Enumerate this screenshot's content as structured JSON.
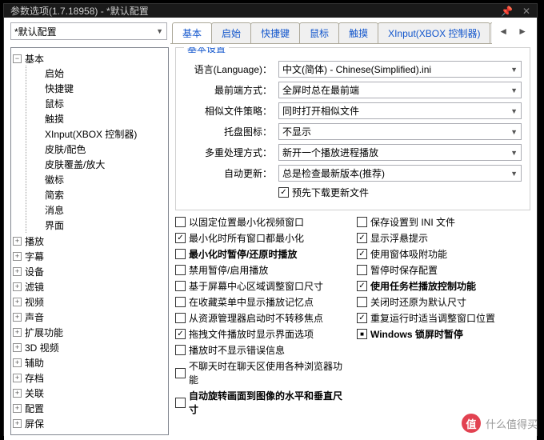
{
  "title": "参数选项(1.7.18958) - *默认配置",
  "config_select": "*默认配置",
  "tabs": [
    "基本",
    "启始",
    "快捷键",
    "鼠标",
    "触摸",
    "XInput(XBOX 控制器)",
    "皮肤/酉"
  ],
  "active_tab": 0,
  "tree": {
    "root": "基本",
    "basic_children": [
      "启始",
      "快捷键",
      "鼠标",
      "触摸",
      "XInput(XBOX 控制器)",
      "皮肤/配色",
      "皮肤覆盖/放大",
      "徽标",
      "简索",
      "消息",
      "界面"
    ],
    "siblings": [
      "播放",
      "字幕",
      "设备",
      "滤镜",
      "视频",
      "声音",
      "扩展功能",
      "3D 视频",
      "辅助",
      "存档",
      "关联",
      "配置",
      "屏保"
    ]
  },
  "fieldset_title": "基本设置",
  "settings": {
    "language_label": "语言(Language)：",
    "language_value": "中文(简体) - Chinese(Simplified).ini",
    "front_label": "最前端方式：",
    "front_value": "全屏时总在最前端",
    "similar_label": "相似文件策略：",
    "similar_value": "同时打开相似文件",
    "tray_label": "托盘图标：",
    "tray_value": "不显示",
    "multi_label": "多重处理方式：",
    "multi_value": "新开一个播放进程播放",
    "update_label": "自动更新：",
    "update_value": "总是检查最新版本(推荐)",
    "predownload": "预先下载更新文件"
  },
  "left_checks": [
    {
      "label": "以固定位置最小化视频窗口",
      "checked": false,
      "bold": false
    },
    {
      "label": "最小化时所有窗口都最小化",
      "checked": true,
      "bold": false
    },
    {
      "label": "最小化时暂停/还原时播放",
      "checked": false,
      "bold": true
    },
    {
      "label": "禁用暂停/启用播放",
      "checked": false,
      "bold": false
    },
    {
      "label": "基于屏幕中心区域调整窗口尺寸",
      "checked": false,
      "bold": false
    },
    {
      "label": "在收藏菜单中显示播放记忆点",
      "checked": false,
      "bold": false
    },
    {
      "label": "从资源管理器启动时不转移焦点",
      "checked": false,
      "bold": false
    },
    {
      "label": "拖拽文件播放时显示界面选项",
      "checked": true,
      "bold": false
    },
    {
      "label": "播放时不显示错误信息",
      "checked": false,
      "bold": false
    },
    {
      "label": "不聊天时在聊天区使用各种浏览器功能",
      "checked": false,
      "bold": false
    },
    {
      "label": "自动旋转画面到图像的水平和垂直尺寸",
      "checked": false,
      "bold": true
    }
  ],
  "right_checks": [
    {
      "label": "保存设置到 INI 文件",
      "checked": false,
      "bold": false
    },
    {
      "label": "显示浮悬提示",
      "checked": true,
      "bold": false
    },
    {
      "label": "使用窗体吸附功能",
      "checked": true,
      "bold": false
    },
    {
      "label": "暂停时保存配置",
      "checked": false,
      "bold": false
    },
    {
      "label": "使用任务栏播放控制功能",
      "checked": true,
      "bold": true
    },
    {
      "label": "关闭时还原为默认尺寸",
      "checked": false,
      "bold": false
    },
    {
      "label": "重复运行时适当调整窗口位置",
      "checked": true,
      "bold": false
    },
    {
      "label": "Windows 锁屏时暂停",
      "checked": "square",
      "bold": true
    }
  ],
  "watermark": "什么值得买"
}
